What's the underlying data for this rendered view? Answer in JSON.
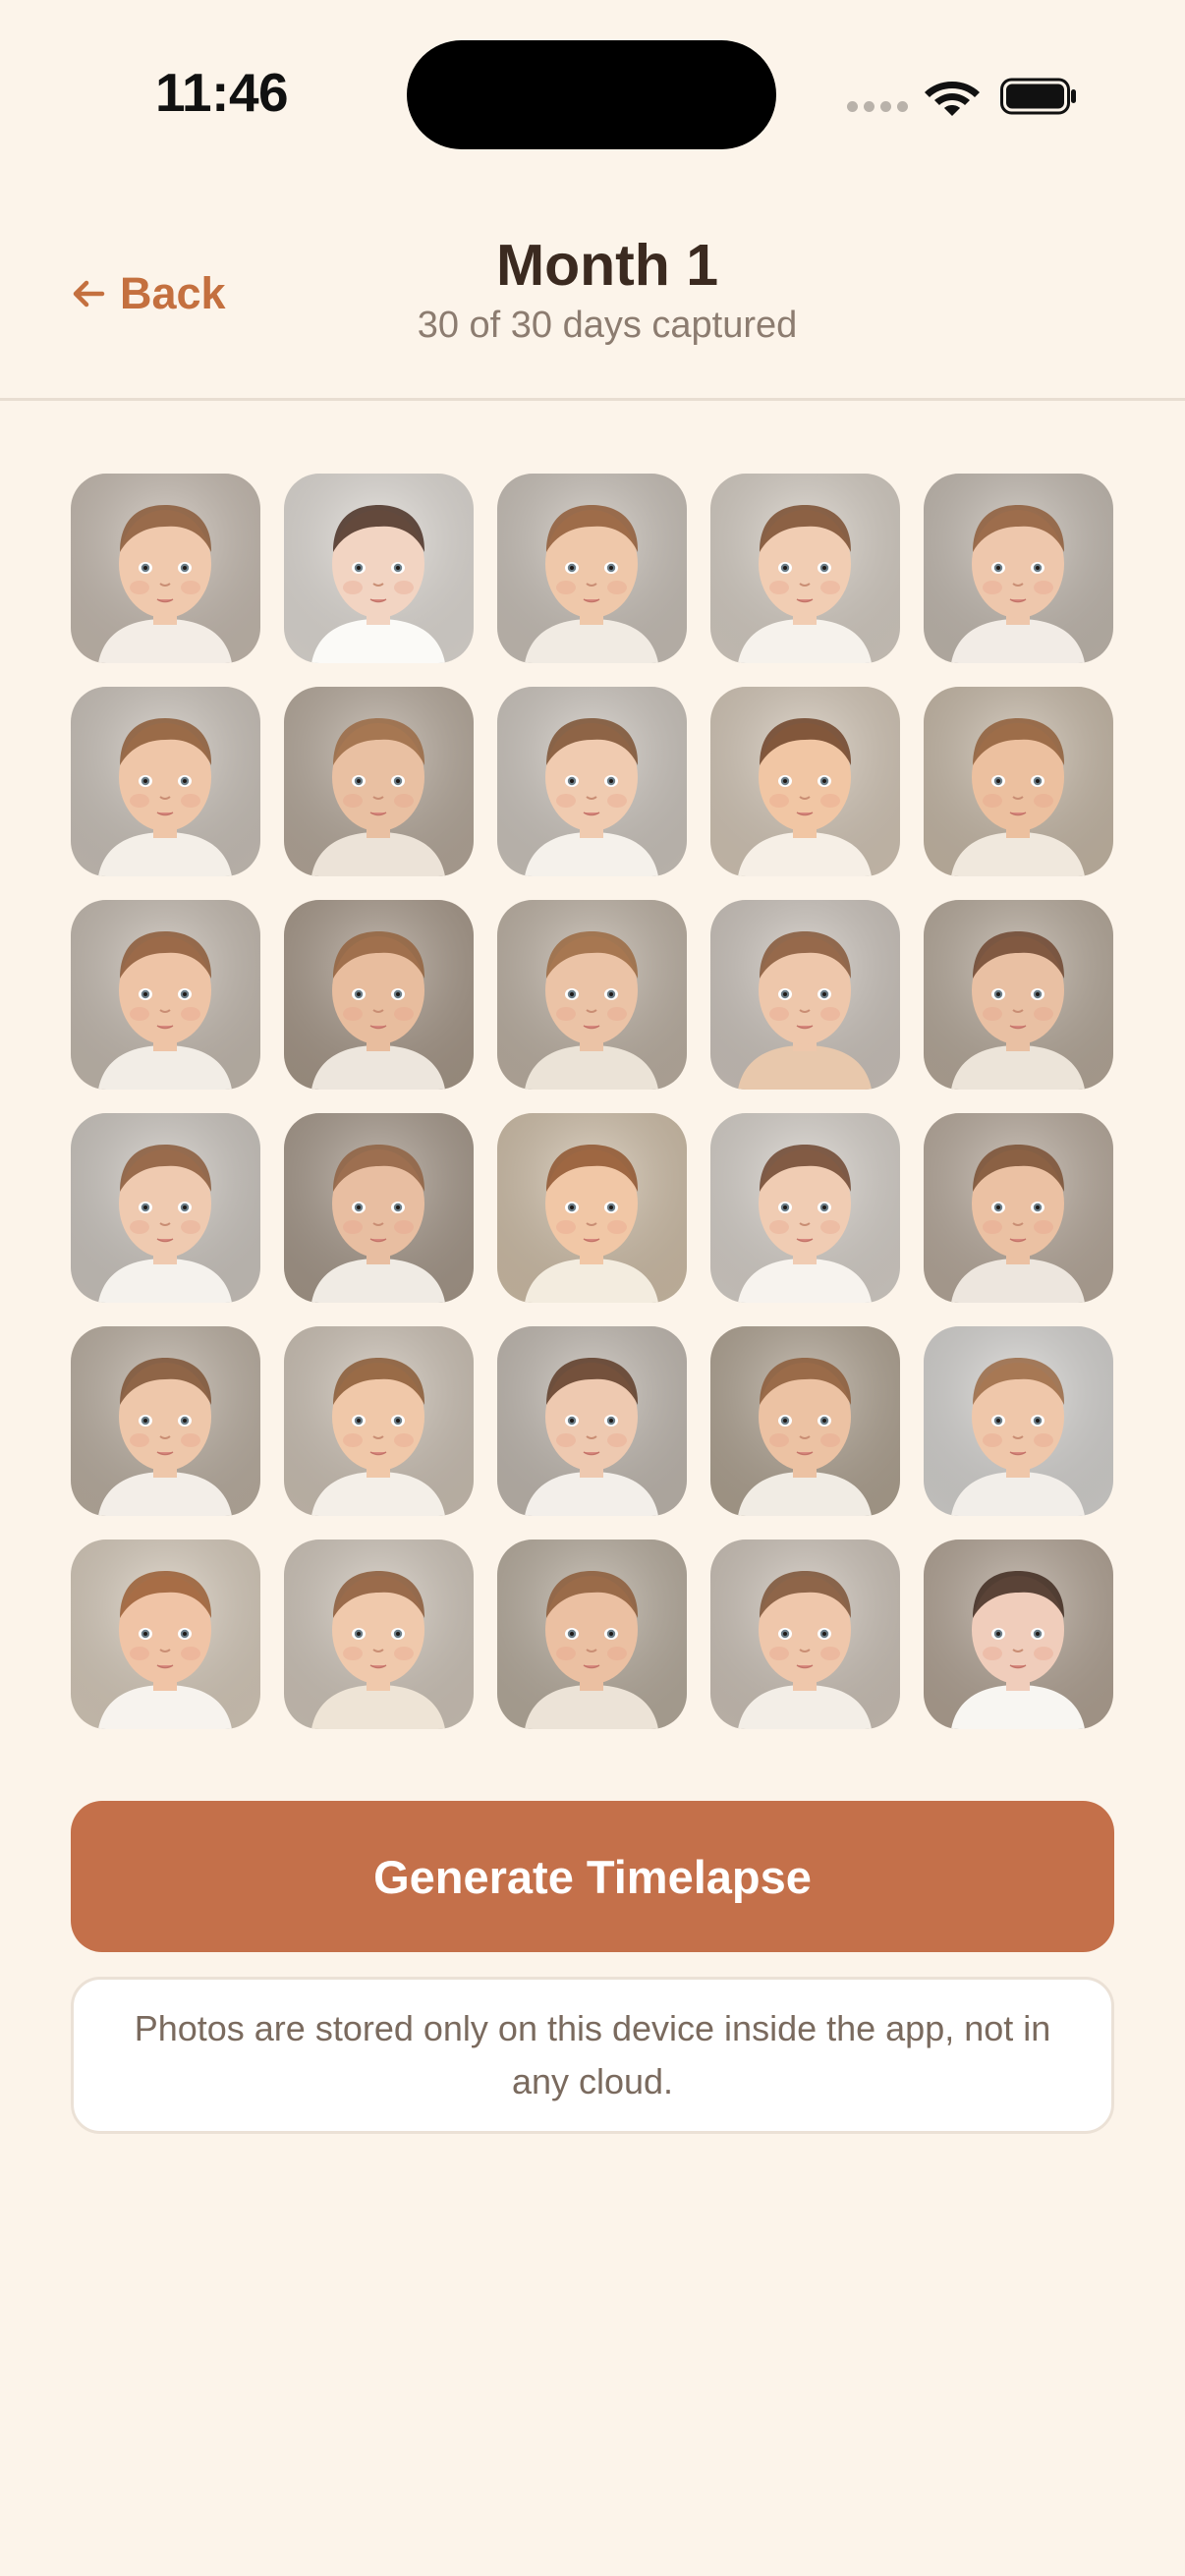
{
  "status_bar": {
    "time": "11:46"
  },
  "header": {
    "back_label": "Back",
    "back_icon": "arrow-left-icon",
    "title": "Month 1",
    "subtitle": "30 of 30 days captured"
  },
  "photo_grid": {
    "photos": [
      {
        "bg": "#c8bdb2",
        "skin": "#f0c9ad",
        "hair": "#8a5a3a",
        "shirt": "#f3ede6"
      },
      {
        "bg": "#e2ddd7",
        "skin": "#f2d4c2",
        "hair": "#4a3024",
        "shirt": "#fbfaf7"
      },
      {
        "bg": "#cbc3ba",
        "skin": "#efc8aa",
        "hair": "#8f5c38",
        "shirt": "#f1ebe3"
      },
      {
        "bg": "#d8d0c6",
        "skin": "#f1cdb3",
        "hair": "#7a4e30",
        "shirt": "#f6f2ec"
      },
      {
        "bg": "#c5bcb2",
        "skin": "#eec7ac",
        "hair": "#8e5d3b",
        "shirt": "#f2ece6"
      },
      {
        "bg": "#cdc5bc",
        "skin": "#efc6a8",
        "hair": "#8b5a37",
        "shirt": "#f4efe8"
      },
      {
        "bg": "#b8ab9d",
        "skin": "#e9c0a2",
        "hair": "#9a6a44",
        "shirt": "#ece3d8"
      },
      {
        "bg": "#cfc8c0",
        "skin": "#f0cbb0",
        "hair": "#7d5234",
        "shirt": "#f5f1eb"
      },
      {
        "bg": "#d6c9b9",
        "skin": "#f1c6a4",
        "hair": "#6e4329",
        "shirt": "#f6efe6"
      },
      {
        "bg": "#c9bba9",
        "skin": "#ecc09f",
        "hair": "#8f5e3a",
        "shirt": "#f0e8dd"
      },
      {
        "bg": "#c7bdb2",
        "skin": "#eec4a6",
        "hair": "#8c5b38",
        "shirt": "#f2ede6"
      },
      {
        "bg": "#a99a8b",
        "skin": "#e8bd9e",
        "hair": "#93633e",
        "shirt": "#ede6dd"
      },
      {
        "bg": "#bfb3a5",
        "skin": "#ebc3a6",
        "hair": "#9b6a42",
        "shirt": "#ebe3d7"
      },
      {
        "bg": "#cfc7bf",
        "skin": "#eec7ab",
        "hair": "#86583a",
        "shirt": "#e8c8ac"
      },
      {
        "bg": "#b8ab9c",
        "skin": "#e9c0a3",
        "hair": "#6f4630",
        "shirt": "#ece4d9"
      },
      {
        "bg": "#cfc9c2",
        "skin": "#efcab0",
        "hair": "#8a5b3b",
        "shirt": "#f5f2ed"
      },
      {
        "bg": "#a89a8c",
        "skin": "#e8bea1",
        "hair": "#8f6142",
        "shirt": "#f0ebe4"
      },
      {
        "bg": "#d2c1aa",
        "skin": "#f1c7a6",
        "hair": "#8f5630",
        "shirt": "#f3ecdf"
      },
      {
        "bg": "#d9d3cc",
        "skin": "#f0ccb3",
        "hair": "#6e4630",
        "shirt": "#f7f3ee"
      },
      {
        "bg": "#b9ab9d",
        "skin": "#ebc1a3",
        "hair": "#7a5034",
        "shirt": "#ede6de"
      },
      {
        "bg": "#bdb1a3",
        "skin": "#eec7aa",
        "hair": "#7e5436",
        "shirt": "#f3eee8"
      },
      {
        "bg": "#cfc4b7",
        "skin": "#f0c8a9",
        "hair": "#8a5a36",
        "shirt": "#f4efe8"
      },
      {
        "bg": "#c3bbb2",
        "skin": "#eec9b0",
        "hair": "#5e3c28",
        "shirt": "#f3efea"
      },
      {
        "bg": "#b2a594",
        "skin": "#ecc2a3",
        "hair": "#8c5c39",
        "shirt": "#f1ece4"
      },
      {
        "bg": "#d8d6d3",
        "skin": "#efc7aa",
        "hair": "#9a6a45",
        "shirt": "#f2eee9"
      },
      {
        "bg": "#d9cdbd",
        "skin": "#f0c4a6",
        "hair": "#9a5e35",
        "shirt": "#f7f3ee"
      },
      {
        "bg": "#d2c8bc",
        "skin": "#f0c9ac",
        "hair": "#8b5b39",
        "shirt": "#eee4d6"
      },
      {
        "bg": "#b9ae9f",
        "skin": "#ebc0a2",
        "hair": "#8c5c3a",
        "shirt": "#ece3d7"
      },
      {
        "bg": "#cfc5ba",
        "skin": "#efc7ab",
        "hair": "#7d5337",
        "shirt": "#f3eee7"
      },
      {
        "bg": "#b4a596",
        "skin": "#f0cdbb",
        "hair": "#3f2a20",
        "shirt": "#f8f6f2"
      }
    ]
  },
  "actions": {
    "generate_label": "Generate Timelapse",
    "privacy_note": "Photos are stored only on this device inside the app, not in any cloud."
  },
  "colors": {
    "background": "#fcf4ea",
    "accent": "#c4704a",
    "back_text": "#c4703f",
    "title_text": "#3b2a20",
    "subtitle_text": "#8c7c70"
  }
}
